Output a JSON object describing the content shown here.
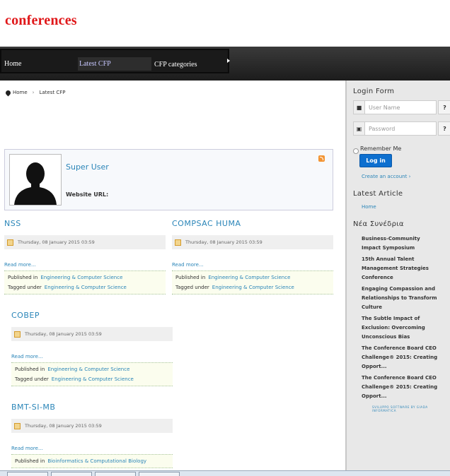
{
  "site": {
    "brand": "conferences"
  },
  "nav": {
    "items": [
      "Home",
      "Latest CFP",
      "CFP categories"
    ]
  },
  "breadcrumb": {
    "home": "Home",
    "current": "Latest CFP"
  },
  "author": {
    "name": "Super User",
    "website_label": "Website URL:"
  },
  "articles": [
    {
      "title": "NSS",
      "date": "Thursday, 08 January 2015 03:59",
      "read_more": "Read more...",
      "published_label": "Published in",
      "category": "Engineering & Computer Science",
      "tagged_label": "Tagged under",
      "tag": "Engineering & Computer Science"
    },
    {
      "title": "COMPSAC HUMA",
      "date": "Thursday, 08 January 2015 03:59",
      "read_more": "Read more...",
      "published_label": "Published in",
      "category": "Engineering & Computer Science",
      "tagged_label": "Tagged under",
      "tag": "Engineering & Computer Science"
    },
    {
      "title": "COBEP",
      "date": "Thursday, 08 January 2015 03:59",
      "read_more": "Read more...",
      "published_label": "Published in",
      "category": "Engineering & Computer Science",
      "tagged_label": "Tagged under",
      "tag": "Engineering & Computer Science"
    },
    {
      "title": "BMT-SI-MB",
      "date": "Thursday, 08 January 2015 03:59",
      "read_more": "Read more...",
      "published_label": "Published in",
      "category": "Bioinformatics & Computational Biology"
    }
  ],
  "sidebar": {
    "login_title": "Login Form",
    "username_placeholder": "User Name",
    "password_placeholder": "Password",
    "remember": "Remember Me",
    "login_button": "Log in",
    "create_account": "Create an account",
    "latest_title": "Latest Article",
    "latest_home": "Home",
    "new_conf_title": "Νέα Συνέδρια",
    "conferences": [
      "Business-Community Impact Symposium",
      "15th Annual Talent Management Strategies Conference",
      "Engaging Compassion and Relationships to Transform Culture",
      "The Subtle Impact of Exclusion: Overcoming Unconscious Bias",
      "The Conference Board CEO Challenge® 2015: Creating Opport...",
      "The Conference Board CEO Challenge® 2015: Creating Opport..."
    ],
    "credit": "SVILUPPO SOFTWARE BY GIADA INFORMATICA"
  },
  "colors": {
    "brand": "#e0181a",
    "link": "#2a85b8",
    "nav_bg": "#1a1a1a",
    "button": "#0d6fcf"
  }
}
